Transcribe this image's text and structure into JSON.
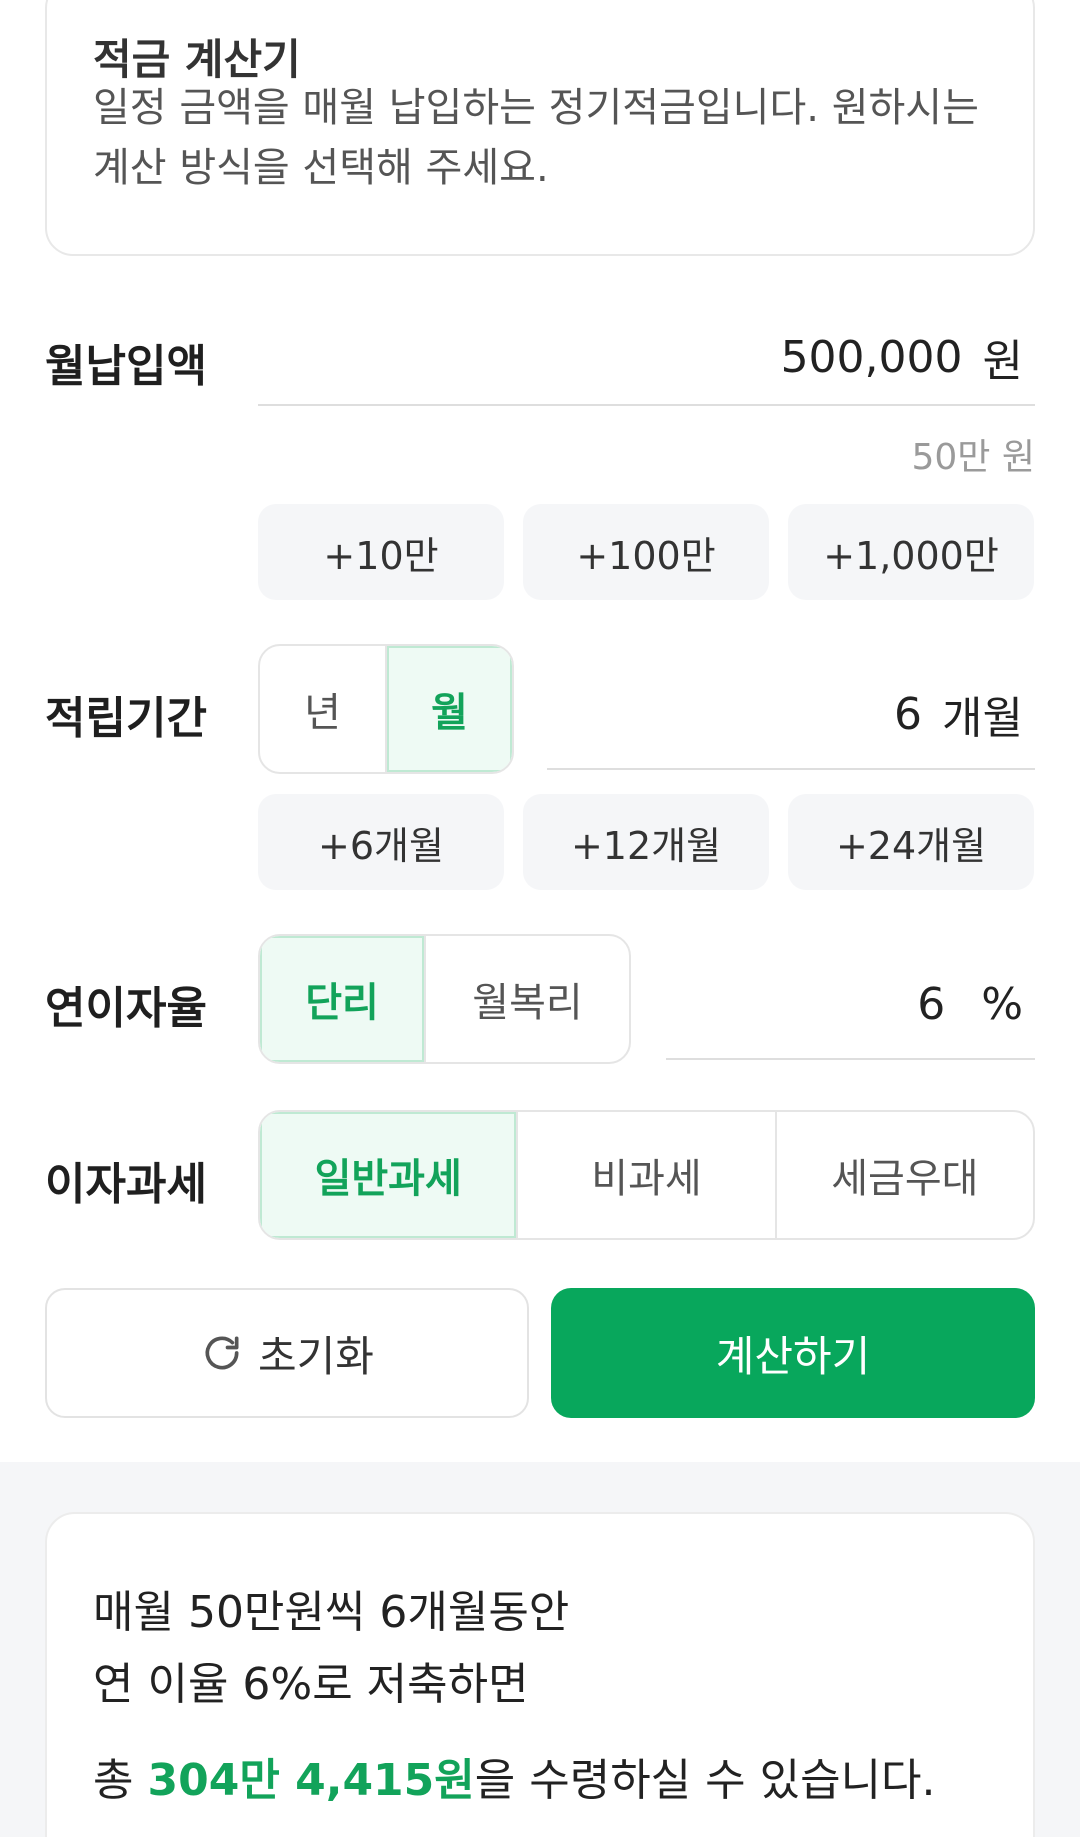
{
  "intro": {
    "title": "적금 계산기",
    "description": "일정 금액을 매월 납입하는 정기적금입니다. 원하시는 계산 방식을 선택해 주세요."
  },
  "monthly_payment": {
    "label": "월납입액",
    "value": "500,000",
    "unit": "원",
    "hint": "50만 원",
    "chips": [
      "+10만",
      "+100만",
      "+1,000만"
    ]
  },
  "period": {
    "label": "적립기간",
    "toggle": [
      "년",
      "월"
    ],
    "selected": "월",
    "value": "6",
    "unit": "개월",
    "chips": [
      "+6개월",
      "+12개월",
      "+24개월"
    ]
  },
  "interest_rate": {
    "label": "연이자율",
    "toggle": [
      "단리",
      "월복리"
    ],
    "selected": "단리",
    "value": "6",
    "unit": "%"
  },
  "tax": {
    "label": "이자과세",
    "options": [
      "일반과세",
      "비과세",
      "세금우대"
    ],
    "selected": "일반과세"
  },
  "actions": {
    "reset_label": "초기화",
    "calculate_label": "계산하기"
  },
  "result": {
    "line1": "매월 50만원씩 6개월동안",
    "line2": "연 이율 6%로 저축하면",
    "total_prefix": "총 ",
    "total_amount": "304만 4,415원",
    "total_suffix": "을 수령하실 수 있습니다."
  },
  "colors": {
    "accent": "#08a75c",
    "accent_text": "#12a35a",
    "active_bg": "#eefaf4",
    "chip_bg": "#f5f6f8"
  }
}
